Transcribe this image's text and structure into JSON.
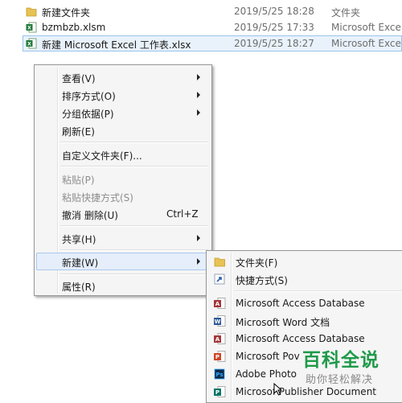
{
  "files": [
    {
      "name": "新建文件夹",
      "date": "2019/5/25 18:28",
      "type": "文件夹",
      "icon": "folder-icon"
    },
    {
      "name": "bzmbzb.xlsm",
      "date": "2019/5/25 17:33",
      "type": "Microsoft Exce",
      "icon": "excel-icon"
    },
    {
      "name": "新建 Microsoft Excel 工作表.xlsx",
      "date": "2019/5/25 18:27",
      "type": "Microsoft Exce",
      "icon": "excel-icon"
    }
  ],
  "context_menu": {
    "view": "查看(V)",
    "sort": "排序方式(O)",
    "group": "分组依据(P)",
    "refresh": "刷新(E)",
    "customize": "自定义文件夹(F)...",
    "paste": "粘贴(P)",
    "paste_shortcut": "粘贴快捷方式(S)",
    "undo": "撤消 删除(U)",
    "undo_shortcut": "Ctrl+Z",
    "share": "共享(H)",
    "new": "新建(W)",
    "properties": "属性(R)"
  },
  "new_submenu": [
    {
      "label": "文件夹(F)",
      "icon": "folder-icon"
    },
    {
      "label": "快捷方式(S)",
      "icon": "shortcut-icon"
    },
    {
      "label": "Microsoft Access Database",
      "icon": "access-icon"
    },
    {
      "label": "Microsoft Word 文档",
      "icon": "word-icon"
    },
    {
      "label": "Microsoft Access Database",
      "icon": "access-icon"
    },
    {
      "label": "Microsoft Pov",
      "icon": "powerpoint-icon"
    },
    {
      "label": "Adobe Photo",
      "icon": "photoshop-icon"
    },
    {
      "label": "Microsof Publisher Document",
      "icon": "publisher-icon"
    }
  ],
  "watermark": {
    "title": "百科全说",
    "subtitle": "助你轻松解决"
  },
  "colors": {
    "selection": "#e9f2fb",
    "menu_bg": "#f5f5f5",
    "watermark_green": "#1f9a4a"
  }
}
